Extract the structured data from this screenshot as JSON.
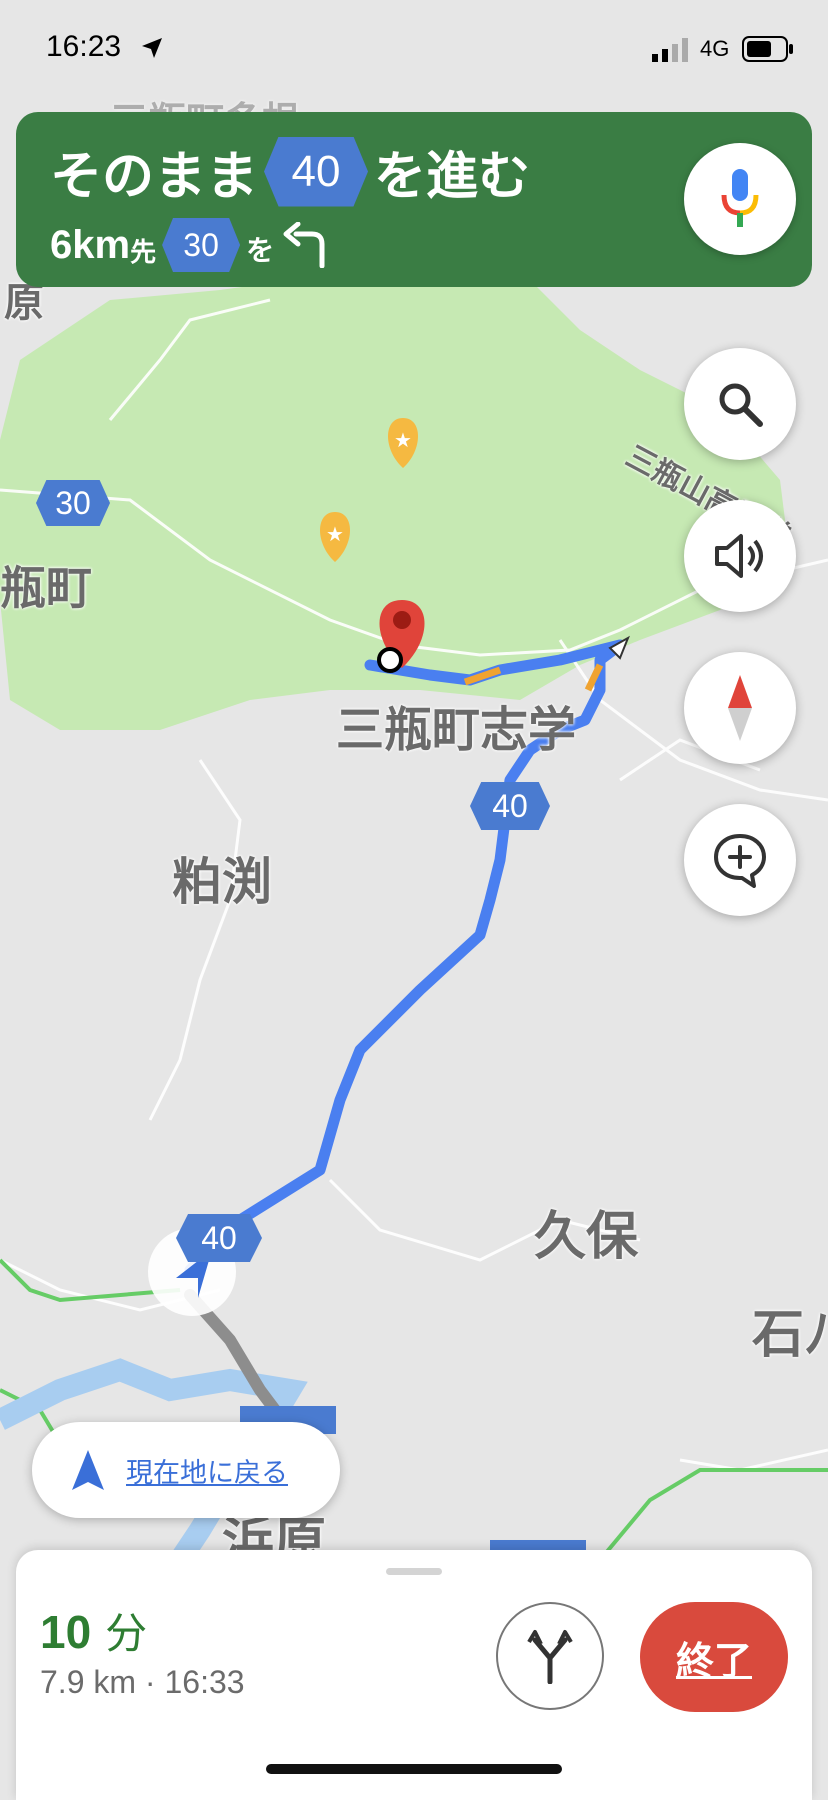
{
  "status_bar": {
    "time": "16:23",
    "network": "4G"
  },
  "nav_banner": {
    "line1_prefix": "そのまま",
    "line1_route": "40",
    "line1_suffix": "を進む",
    "line2_distance": "6km",
    "line2_ahead": "先",
    "line2_route": "30",
    "line2_particle": "を"
  },
  "map": {
    "labels": {
      "top_faded": "三瓶町多根",
      "left_edge": "原",
      "mitoya": "瓶町",
      "kogen": "三瓶山高原道",
      "shigaku": "三瓶町志学",
      "kasubuchi": "粕渕",
      "kubo": "久保",
      "ishi": "石ﾉ",
      "hamahara": "浜原"
    },
    "route_shields": {
      "r30": "30",
      "r40_upper": "40",
      "r40_lower": "40"
    },
    "colors": {
      "route": "#4a7ff0",
      "park": "#c6e9b3",
      "banner": "#3a7d44",
      "pin": "#e0443a"
    }
  },
  "recenter": {
    "label": "現在地に戻る"
  },
  "bottom_sheet": {
    "eta_minutes": "10",
    "eta_unit": "分",
    "summary": "7.9 km · 16:33",
    "end_label": "終了"
  }
}
